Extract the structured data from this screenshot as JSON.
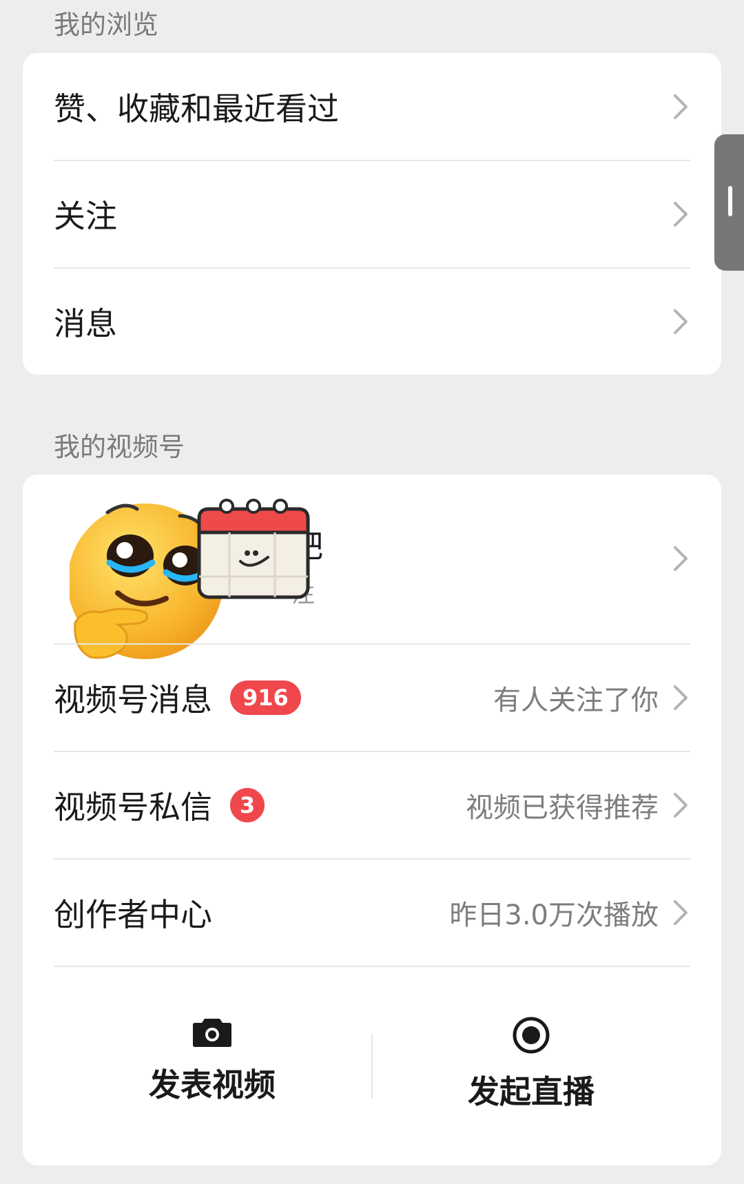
{
  "browse_section": {
    "title": "我的浏览",
    "items": [
      {
        "label": "赞、收藏和最近看过"
      },
      {
        "label": "关注"
      },
      {
        "label": "消息"
      }
    ]
  },
  "channels_section": {
    "title": "我的视频号",
    "profile": {
      "name": "吧",
      "subtitle": "注"
    },
    "items": [
      {
        "label": "视频号消息",
        "badge": "916",
        "right_text": "有人关注了你"
      },
      {
        "label": "视频号私信",
        "badge": "3",
        "right_text": "视频已获得推荐"
      },
      {
        "label": "创作者中心",
        "badge": "",
        "right_text": "昨日3.0万次播放"
      }
    ],
    "actions": {
      "post_video": {
        "label": "发表视频",
        "icon": "camera-icon"
      },
      "start_live": {
        "label": "发起直播",
        "icon": "live-record-icon"
      }
    }
  },
  "colors": {
    "badge": "#f0474c",
    "background": "#ededed",
    "card": "#ffffff"
  }
}
